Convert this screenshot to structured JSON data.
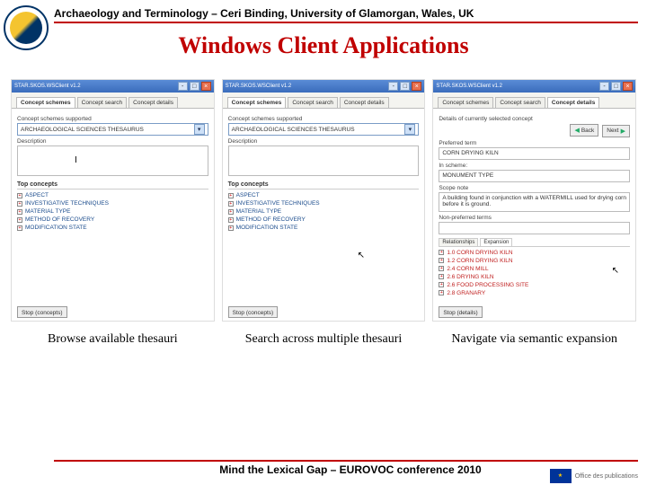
{
  "header": "Archaeology and Terminology – Ceri Binding, University of Glamorgan, Wales, UK",
  "title": "Windows Client Applications",
  "shots": [
    {
      "window_title": "STAR.SKOS.WSClient v1.2",
      "tabs": [
        "Concept schemes",
        "Concept search",
        "Concept details"
      ],
      "active_tab": 0,
      "section": "Concept schemes supported",
      "combo": "ARCHAEOLOGICAL SCIENCES THESAURUS",
      "desc_label": "Description",
      "top_label": "Top concepts",
      "top_items": [
        "ASPECT",
        "INVESTIGATIVE TECHNIQUES",
        "MATERIAL TYPE",
        "METHOD OF RECOVERY",
        "MODIFICATION STATE"
      ],
      "stop": "Stop (concepts)"
    },
    {
      "window_title": "STAR.SKOS.WSClient v1.2",
      "tabs": [
        "Concept schemes",
        "Concept search",
        "Concept details"
      ],
      "active_tab": 0,
      "section": "Concept schemes supported",
      "combo": "ARCHAEOLOGICAL SCIENCES THESAURUS",
      "desc_label": "Description",
      "top_label": "Top concepts",
      "top_items": [
        "ASPECT",
        "INVESTIGATIVE TECHNIQUES",
        "MATERIAL TYPE",
        "METHOD OF RECOVERY",
        "MODIFICATION STATE"
      ],
      "stop": "Stop (concepts)"
    },
    {
      "window_title": "STAR.SKOS.WSClient v1.2",
      "tabs": [
        "Concept schemes",
        "Concept search",
        "Concept details"
      ],
      "active_tab": 2,
      "section": "Details of currently selected concept",
      "back": "Back",
      "next": "Next",
      "pref_label": "Preferred term",
      "pref_val": "CORN DRYING KILN",
      "scheme_label": "In scheme:",
      "scheme_val": "MONUMENT TYPE",
      "notes_label": "Scope note",
      "notes_val": "A building found in conjunction with a WATERMILL used for drying corn before it is ground.",
      "nonpref_label": "Non-preferred terms",
      "subtabs": [
        "Relationships",
        "Expansion"
      ],
      "exp_items": [
        "1.0 CORN DRYING KILN",
        "1.2 CORN DRYING KILN",
        "2.4 CORN MILL",
        "2.6 DRYING KILN",
        "2.6 FOOD PROCESSING SITE",
        "2.8 GRANARY"
      ],
      "stop": "Stop (details)"
    }
  ],
  "captions": [
    "Browse available thesauri",
    "Search across multiple thesauri",
    "Navigate via semantic expansion"
  ],
  "footer": "Mind the Lexical Gap – EUROVOC conference 2010",
  "publisher": "Office des publications"
}
